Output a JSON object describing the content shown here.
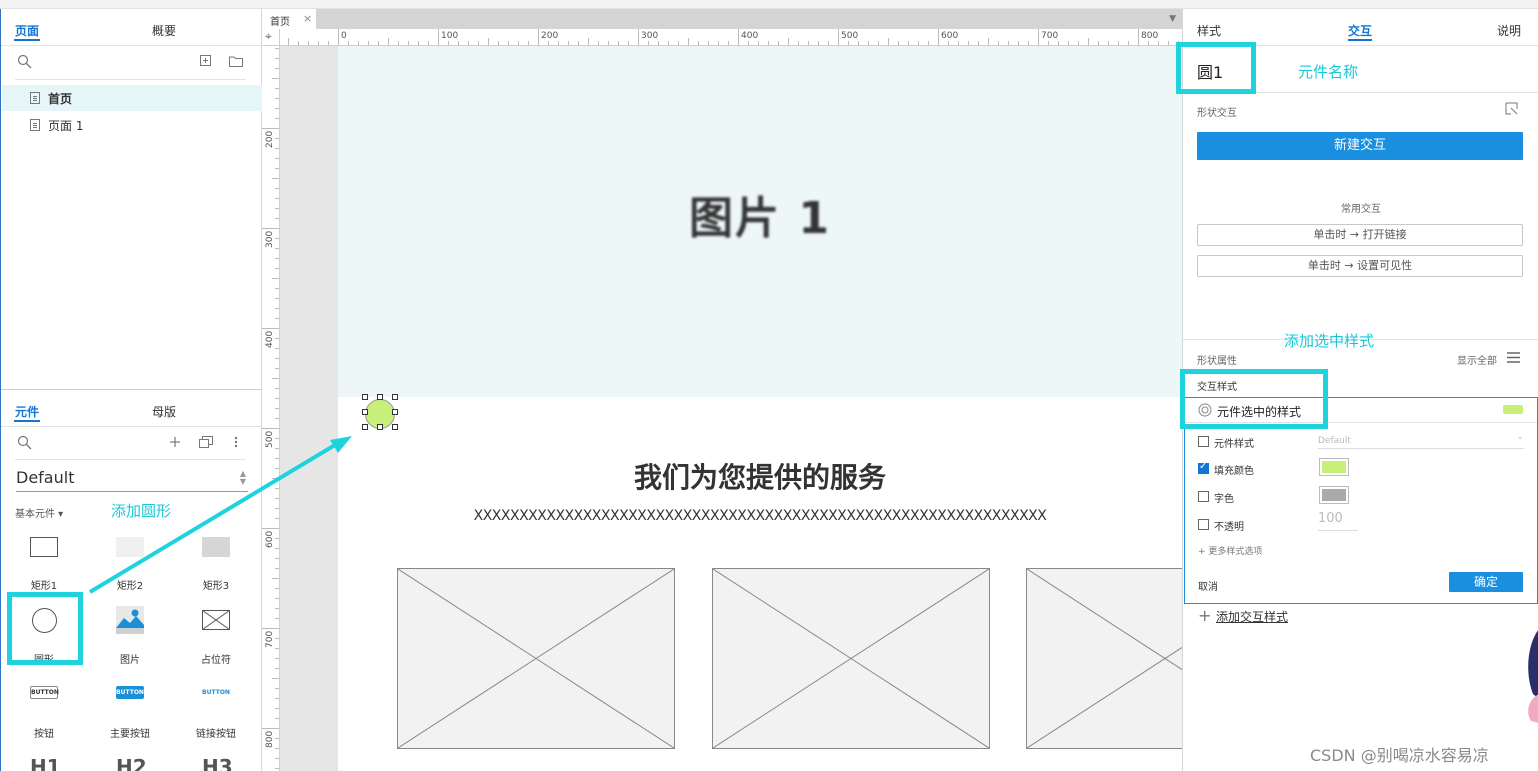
{
  "left_panel": {
    "tabs": {
      "pages": "页面",
      "outline": "概要"
    },
    "pages": [
      {
        "label": "首页",
        "selected": true
      },
      {
        "label": "页面 1",
        "selected": false
      }
    ],
    "library_tabs": {
      "widgets": "元件",
      "masters": "母版"
    },
    "library_name": "Default",
    "category": "基本元件 ▾",
    "widgets": [
      {
        "label": "矩形1",
        "icon": "rectangle-icon"
      },
      {
        "label": "矩形2",
        "icon": "rectangle-gray-icon"
      },
      {
        "label": "矩形3",
        "icon": "rectangle-dark-icon"
      },
      {
        "label": "圆形",
        "icon": "circle-icon"
      },
      {
        "label": "图片",
        "icon": "image-icon"
      },
      {
        "label": "占位符",
        "icon": "placeholder-icon"
      },
      {
        "label": "按钮",
        "icon": "button-icon",
        "text": "BUTTON"
      },
      {
        "label": "主要按钮",
        "icon": "primary-button-icon",
        "text": "BUTTON"
      },
      {
        "label": "链接按钮",
        "icon": "link-button-icon",
        "text": "BUTTON"
      }
    ],
    "headings": [
      "H1",
      "H2",
      "H3"
    ]
  },
  "canvas": {
    "doc_tab": "首页",
    "ruler_top": [
      "0",
      "100",
      "200",
      "300",
      "400",
      "500",
      "600",
      "700",
      "800"
    ],
    "ruler_left": [
      "200",
      "300",
      "400",
      "500",
      "600",
      "700",
      "800"
    ],
    "hero_text": "图片 1",
    "service_title": "我们为您提供的服务",
    "service_subtitle": "XXXXXXXXXXXXXXXXXXXXXXXXXXXXXXXXXXXXXXXXXXXXXXXXXXXXXXXXXXXXXXX",
    "selected_circle_color": "#c6f07a"
  },
  "right_panel": {
    "tabs": {
      "style": "样式",
      "interaction": "交互",
      "notes": "说明"
    },
    "widget_name": "圆1",
    "shape_interaction_label": "形状交互",
    "new_interaction": "新建交互",
    "common_interactions_label": "常用交互",
    "common_interactions": [
      "单击时 → 打开链接",
      "单击时 → 设置可见性"
    ],
    "shape_properties_label": "形状属性",
    "show_all": "显示全部",
    "interaction_styles_label": "交互样式",
    "selected_style_label": "元件选中的样式",
    "selected_style_color": "#c6f07a",
    "style_rows": [
      {
        "label": "元件样式",
        "checked": false,
        "value": "Default"
      },
      {
        "label": "填充颜色",
        "checked": true,
        "color": "#c6f07a"
      },
      {
        "label": "字色",
        "checked": false,
        "color": "#aaaaaa"
      },
      {
        "label": "不透明",
        "checked": false,
        "value": "100"
      }
    ],
    "more_options": "+ 更多样式选项",
    "cancel": "取消",
    "confirm": "确定",
    "add_interaction_style": "添加交互样式"
  },
  "annotations": {
    "widget_name": "元件名称",
    "add_selected_style": "添加选中样式",
    "add_circle": "添加圆形"
  },
  "watermark": "CSDN @别喝凉水容易凉",
  "colors": {
    "accent": "#1576d1",
    "highlight": "#1fd3dd",
    "primary_button": "#1a8fe0"
  }
}
